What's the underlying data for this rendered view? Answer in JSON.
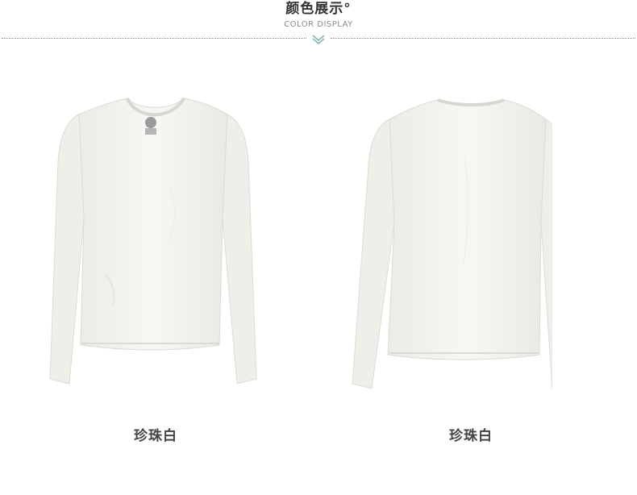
{
  "header": {
    "title": "颜色展示°",
    "subtitle": "COLOR DISPLAY",
    "accent_color": "#7fb8b0"
  },
  "products": [
    {
      "view": "front",
      "caption": "珍珠白",
      "color": "#f6f5f1"
    },
    {
      "view": "back",
      "caption": "珍珠白",
      "color": "#f6f5f1"
    }
  ]
}
